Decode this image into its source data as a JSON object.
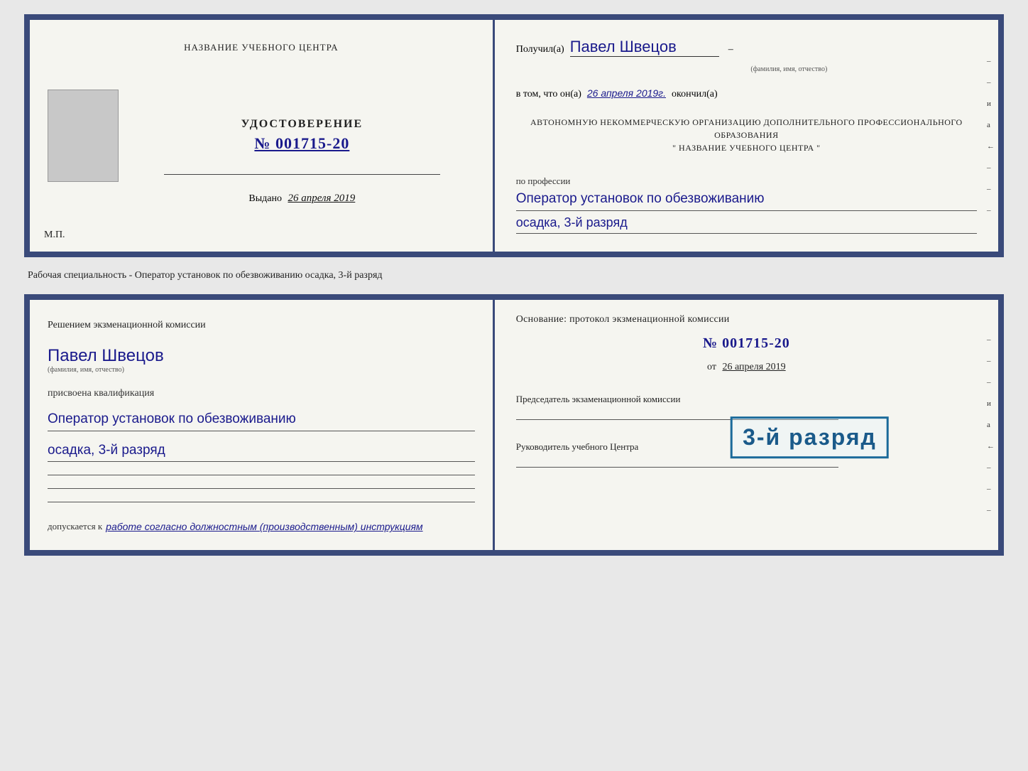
{
  "doc1": {
    "left": {
      "title": "НАЗВАНИЕ УЧЕБНОГО ЦЕНТРА",
      "cert_label": "УДОСТОВЕРЕНИЕ",
      "cert_number": "№ 001715-20",
      "issued_label": "Выдано",
      "issued_date": "26 апреля 2019",
      "mp": "М.П."
    },
    "right": {
      "received_label": "Получил(а)",
      "recipient_name": "Павел Швецов",
      "fio_sublabel": "(фамилия, имя, отчество)",
      "in_that_label": "в том, что он(а)",
      "date_value": "26 апреля 2019г.",
      "finished_label": "окончил(а)",
      "org_block": "АВТОНОМНУЮ НЕКОММЕРЧЕСКУЮ ОРГАНИЗАЦИЮ ДОПОЛНИТЕЛЬНОГО ПРОФЕССИОНАЛЬНОГО ОБРАЗОВАНИЯ",
      "org_name": "\" НАЗВАНИЕ УЧЕБНОГО ЦЕНТРА \"",
      "profession_label": "по профессии",
      "profession_value": "Оператор установок по обезвоживанию",
      "profession_rank": "осадка, 3-й разряд",
      "right_letters": [
        "–",
        "–",
        "и",
        "а",
        "←",
        "–",
        "–",
        "–",
        "–",
        "–"
      ]
    }
  },
  "separator": {
    "text": "Рабочая специальность - Оператор установок по обезвоживанию осадка, 3-й разряд"
  },
  "doc2": {
    "left": {
      "decision_label": "Решением экзменационной комиссии",
      "name_value": "Павел Швецов",
      "fio_sublabel": "(фамилия, имя, отчество)",
      "assigned_label": "присвоена квалификация",
      "qualification_value": "Оператор установок по обезвоживанию",
      "qualification_rank": "осадка, 3-й разряд",
      "admitted_label": "допускается к",
      "admitted_value": "работе согласно должностным (производственным) инструкциям"
    },
    "right": {
      "basis_label": "Основание: протокол экзменационной комиссии",
      "protocol_number": "№ 001715-20",
      "date_prefix": "от",
      "date_value": "26 апреля 2019",
      "chairman_label": "Председатель экзаменационной комиссии",
      "head_label": "Руководитель учебного Центра",
      "right_letters": [
        "–",
        "–",
        "–",
        "и",
        "а",
        "←",
        "–",
        "–",
        "–",
        "–",
        "–"
      ]
    },
    "stamp": {
      "text": "3-й разряд"
    }
  }
}
